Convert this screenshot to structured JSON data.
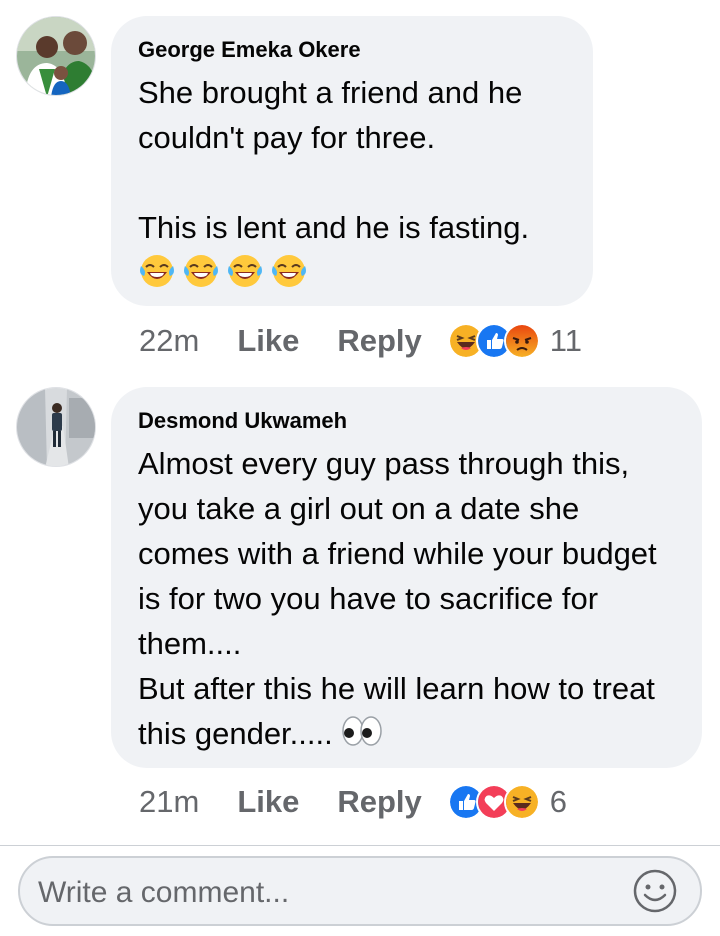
{
  "comments": [
    {
      "author": "George Emeka Okere",
      "body": "She brought a friend and he couldn't pay for three.\n\nThis is lent and he is fasting.",
      "emoji_trailer": [
        "laughing-tears-emoji",
        "laughing-tears-emoji",
        "laughing-tears-emoji",
        "laughing-tears-emoji"
      ],
      "time": "22m",
      "like_label": "Like",
      "reply_label": "Reply",
      "reactions": [
        "haha-reaction",
        "like-reaction",
        "angry-reaction"
      ],
      "reaction_count": "11"
    },
    {
      "author": "Desmond Ukwameh",
      "body": "Almost every guy pass through this, you take a girl out on a date she comes with a friend while your budget is for two you have to sacrifice for them....\nBut after this he will learn how to treat this gender.....",
      "emoji_trailer": [
        "eyes-emoji"
      ],
      "time": "21m",
      "like_label": "Like",
      "reply_label": "Reply",
      "reactions": [
        "like-reaction",
        "love-reaction",
        "haha-reaction"
      ],
      "reaction_count": "6"
    }
  ],
  "composer": {
    "placeholder": "Write a comment..."
  },
  "colors": {
    "bubble": "#f0f2f5",
    "meta_text": "#65676b",
    "like_blue": "#1877f2",
    "love_red": "#f33e58",
    "haha_yellow": "#f7b125",
    "angry_orange": "#e9710f"
  }
}
